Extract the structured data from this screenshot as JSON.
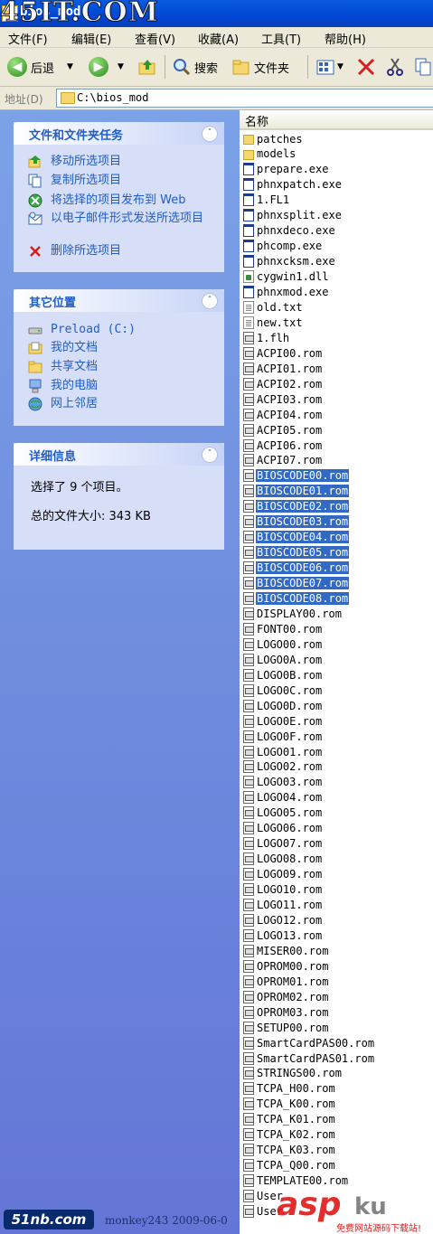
{
  "window": {
    "title": "bios_mod",
    "watermark_top": "45IT.COM"
  },
  "menu": [
    "文件(F)",
    "编辑(E)",
    "查看(V)",
    "收藏(A)",
    "工具(T)",
    "帮助(H)"
  ],
  "toolbar": {
    "back_label": "后退",
    "search_label": "搜索",
    "folders_label": "文件夹"
  },
  "address": {
    "label": "地址(D)",
    "path": "C:\\bios_mod"
  },
  "tasks_panel": {
    "title": "文件和文件夹任务",
    "items": [
      {
        "label": "移动所选项目",
        "icon": "move-icon"
      },
      {
        "label": "复制所选项目",
        "icon": "copy-icon"
      },
      {
        "label": "将选择的项目发布到 Web",
        "icon": "publish-web-icon"
      },
      {
        "label": "以电子邮件形式发送所选项目",
        "icon": "email-icon"
      },
      {
        "label": "删除所选项目",
        "icon": "delete-icon"
      }
    ]
  },
  "places_panel": {
    "title": "其它位置",
    "items": [
      {
        "label": "Preload (C:)",
        "icon": "drive-icon"
      },
      {
        "label": "我的文档",
        "icon": "my-documents-icon"
      },
      {
        "label": "共享文档",
        "icon": "shared-documents-icon"
      },
      {
        "label": "我的电脑",
        "icon": "my-computer-icon"
      },
      {
        "label": "网上邻居",
        "icon": "network-icon"
      }
    ]
  },
  "details_panel": {
    "title": "详细信息",
    "selected": "选择了 9 个项目。",
    "size": "总的文件大小: 343 KB"
  },
  "file_list": {
    "column_name": "名称",
    "files": [
      {
        "name": "patches",
        "type": "folder"
      },
      {
        "name": "models",
        "type": "folder"
      },
      {
        "name": "prepare.exe",
        "type": "exe"
      },
      {
        "name": "phnxpatch.exe",
        "type": "exe"
      },
      {
        "name": "1.FL1",
        "type": "exe"
      },
      {
        "name": "phnxsplit.exe",
        "type": "exe"
      },
      {
        "name": "phnxdeco.exe",
        "type": "exe"
      },
      {
        "name": "phcomp.exe",
        "type": "exe"
      },
      {
        "name": "phnxcksm.exe",
        "type": "exe"
      },
      {
        "name": "cygwin1.dll",
        "type": "dll"
      },
      {
        "name": "phnxmod.exe",
        "type": "exe"
      },
      {
        "name": "old.txt",
        "type": "txt"
      },
      {
        "name": "new.txt",
        "type": "txt"
      },
      {
        "name": "1.flh",
        "type": "rom"
      },
      {
        "name": "ACPI00.rom",
        "type": "rom"
      },
      {
        "name": "ACPI01.rom",
        "type": "rom"
      },
      {
        "name": "ACPI02.rom",
        "type": "rom"
      },
      {
        "name": "ACPI03.rom",
        "type": "rom"
      },
      {
        "name": "ACPI04.rom",
        "type": "rom"
      },
      {
        "name": "ACPI05.rom",
        "type": "rom"
      },
      {
        "name": "ACPI06.rom",
        "type": "rom"
      },
      {
        "name": "ACPI07.rom",
        "type": "rom"
      },
      {
        "name": "BIOSCODE00.rom",
        "type": "rom",
        "selected": true
      },
      {
        "name": "BIOSCODE01.rom",
        "type": "rom",
        "selected": true
      },
      {
        "name": "BIOSCODE02.rom",
        "type": "rom",
        "selected": true
      },
      {
        "name": "BIOSCODE03.rom",
        "type": "rom",
        "selected": true
      },
      {
        "name": "BIOSCODE04.rom",
        "type": "rom",
        "selected": true
      },
      {
        "name": "BIOSCODE05.rom",
        "type": "rom",
        "selected": true
      },
      {
        "name": "BIOSCODE06.rom",
        "type": "rom",
        "selected": true
      },
      {
        "name": "BIOSCODE07.rom",
        "type": "rom",
        "selected": true
      },
      {
        "name": "BIOSCODE08.rom",
        "type": "rom",
        "selected": true
      },
      {
        "name": "DISPLAY00.rom",
        "type": "rom"
      },
      {
        "name": "FONT00.rom",
        "type": "rom"
      },
      {
        "name": "LOGO00.rom",
        "type": "rom"
      },
      {
        "name": "LOGO0A.rom",
        "type": "rom"
      },
      {
        "name": "LOGO0B.rom",
        "type": "rom"
      },
      {
        "name": "LOGO0C.rom",
        "type": "rom"
      },
      {
        "name": "LOGO0D.rom",
        "type": "rom"
      },
      {
        "name": "LOGO0E.rom",
        "type": "rom"
      },
      {
        "name": "LOGO0F.rom",
        "type": "rom"
      },
      {
        "name": "LOGO01.rom",
        "type": "rom"
      },
      {
        "name": "LOGO02.rom",
        "type": "rom"
      },
      {
        "name": "LOGO03.rom",
        "type": "rom"
      },
      {
        "name": "LOGO04.rom",
        "type": "rom"
      },
      {
        "name": "LOGO05.rom",
        "type": "rom"
      },
      {
        "name": "LOGO06.rom",
        "type": "rom"
      },
      {
        "name": "LOGO07.rom",
        "type": "rom"
      },
      {
        "name": "LOGO08.rom",
        "type": "rom"
      },
      {
        "name": "LOGO09.rom",
        "type": "rom"
      },
      {
        "name": "LOGO10.rom",
        "type": "rom"
      },
      {
        "name": "LOGO11.rom",
        "type": "rom"
      },
      {
        "name": "LOGO12.rom",
        "type": "rom"
      },
      {
        "name": "LOGO13.rom",
        "type": "rom"
      },
      {
        "name": "MISER00.rom",
        "type": "rom"
      },
      {
        "name": "OPROM00.rom",
        "type": "rom"
      },
      {
        "name": "OPROM01.rom",
        "type": "rom"
      },
      {
        "name": "OPROM02.rom",
        "type": "rom"
      },
      {
        "name": "OPROM03.rom",
        "type": "rom"
      },
      {
        "name": "SETUP00.rom",
        "type": "rom"
      },
      {
        "name": "SmartCardPAS00.rom",
        "type": "rom"
      },
      {
        "name": "SmartCardPAS01.rom",
        "type": "rom"
      },
      {
        "name": "STRINGS00.rom",
        "type": "rom"
      },
      {
        "name": "TCPA_H00.rom",
        "type": "rom"
      },
      {
        "name": "TCPA_K00.rom",
        "type": "rom"
      },
      {
        "name": "TCPA_K01.rom",
        "type": "rom"
      },
      {
        "name": "TCPA_K02.rom",
        "type": "rom"
      },
      {
        "name": "TCPA_K03.rom",
        "type": "rom"
      },
      {
        "name": "TCPA_Q00.rom",
        "type": "rom"
      },
      {
        "name": "TEMPLATE00.rom",
        "type": "rom"
      },
      {
        "name": "User",
        "type": "rom"
      },
      {
        "name": "User",
        "type": "rom"
      }
    ]
  },
  "watermarks": {
    "site_left": "51nb.com",
    "credit": "monkey243  2009-06-0",
    "site_right": "asp",
    "site_right_suffix": "ku",
    "slogan": "免费网站源码下载站!"
  },
  "colors": {
    "selection": "#316ac5",
    "link": "#215dc6",
    "titlebar": "#0046d5"
  }
}
